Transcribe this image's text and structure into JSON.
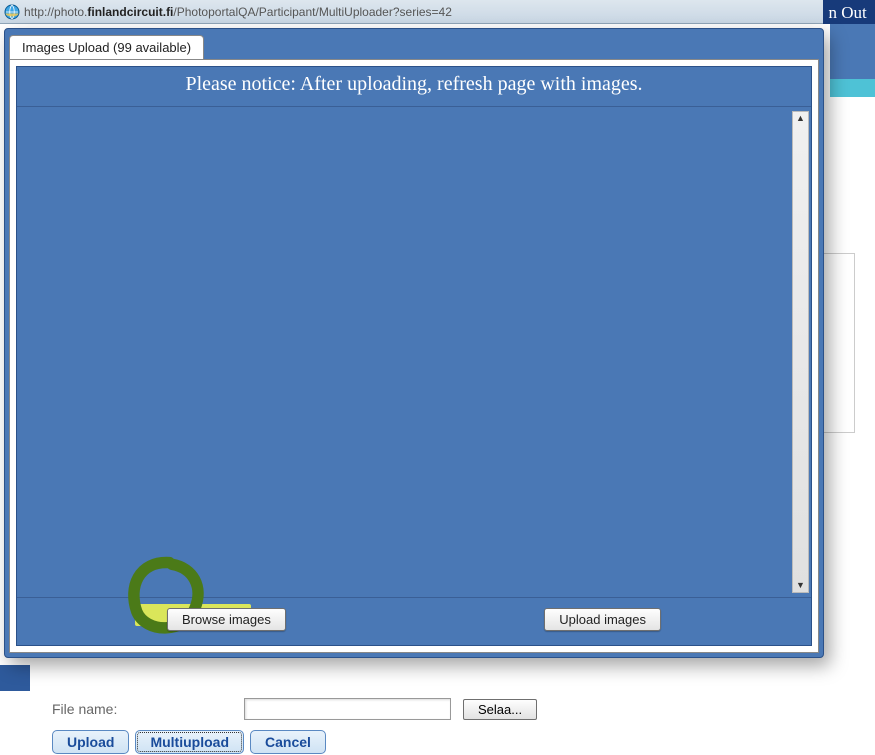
{
  "address_bar": {
    "url_prefix": "http://photo.",
    "url_domain": "finlandcircuit.fi",
    "url_suffix": "/PhotoportalQA/Participant/MultiUploader?series=42"
  },
  "header_fragment": {
    "out_text": "n Out"
  },
  "modal": {
    "tab_label": "Images Upload (99 available)",
    "notice": "Please notice: After uploading, refresh page with images.",
    "browse_button": "Browse images",
    "upload_button": "Upload images"
  },
  "lower_form": {
    "file_label": "File name:",
    "browse_local": "Selaa...",
    "upload": "Upload",
    "multiupload": "Multiupload",
    "cancel": "Cancel"
  }
}
